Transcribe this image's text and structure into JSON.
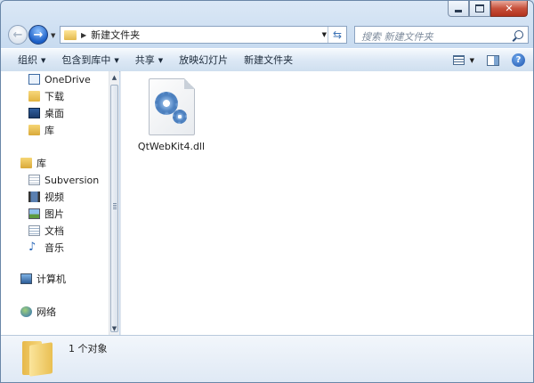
{
  "address": {
    "path": "新建文件夹"
  },
  "search": {
    "placeholder": "搜索 新建文件夹"
  },
  "toolbar": {
    "organize": "组织",
    "include": "包含到库中",
    "share": "共享",
    "slideshow": "放映幻灯片",
    "new_folder": "新建文件夹"
  },
  "nav": {
    "onedrive": "OneDrive",
    "downloads": "下载",
    "desktop": "桌面",
    "libraries_fav": "库",
    "libraries": "库",
    "subversion": "Subversion",
    "videos": "视频",
    "pictures": "图片",
    "documents": "文档",
    "music": "音乐",
    "computer": "计算机",
    "network": "网络"
  },
  "files": [
    {
      "name": "QtWebKit4.dll",
      "icon": "dll-file-icon"
    }
  ],
  "details": {
    "count": "1 个对象"
  },
  "colors": {
    "accent": "#1c5fc6",
    "toolbar": "#dce8f5",
    "folder": "#f1c85f"
  }
}
